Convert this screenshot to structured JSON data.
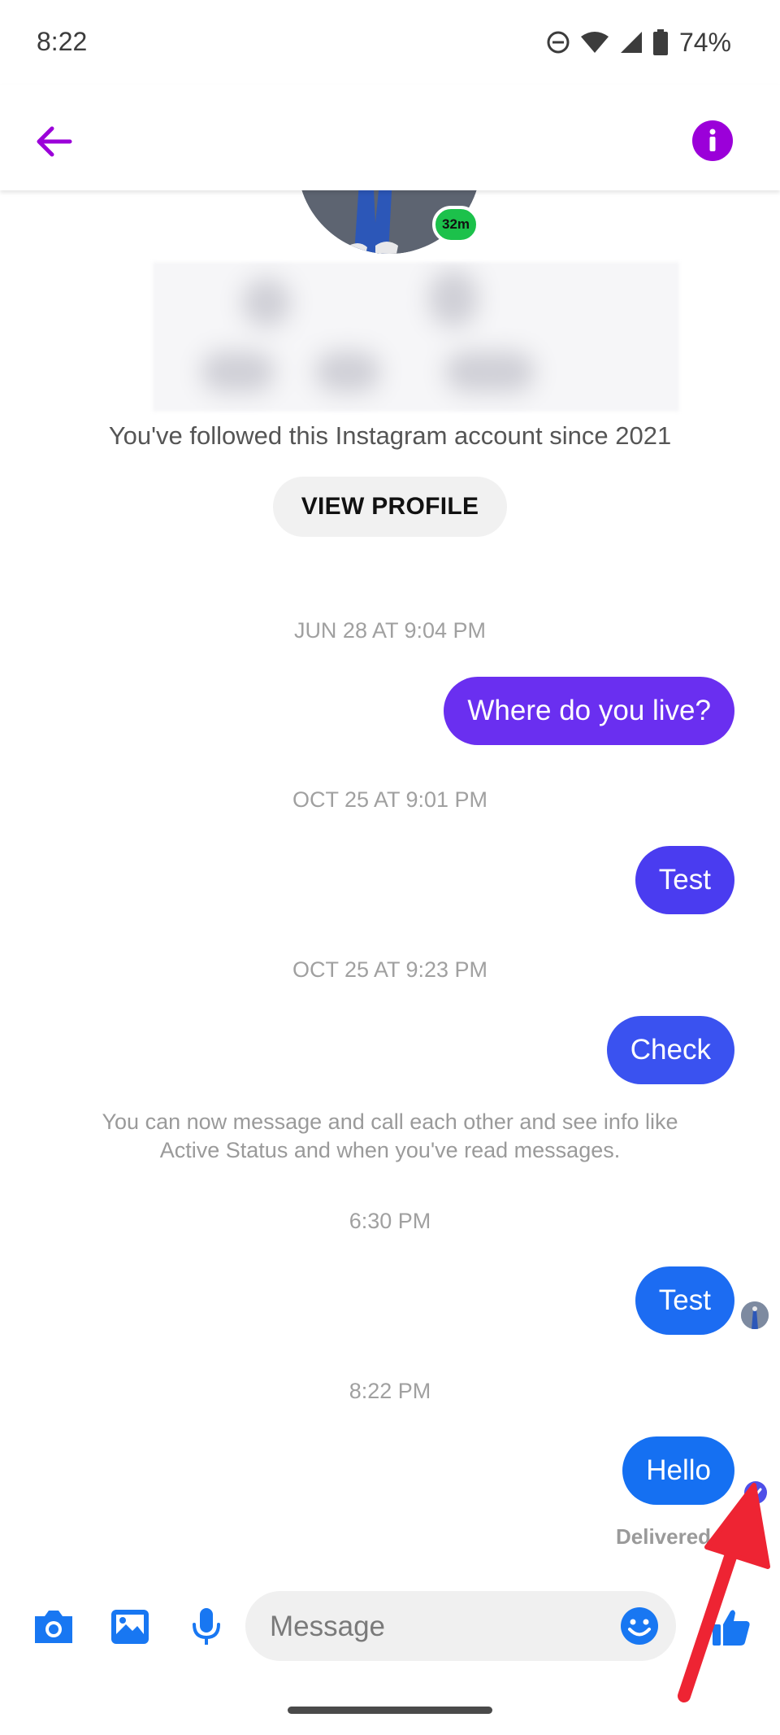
{
  "status_bar": {
    "time": "8:22",
    "battery_percent": "74%",
    "icons": [
      "do-not-disturb-icon",
      "wifi-icon",
      "cell-signal-icon",
      "battery-icon"
    ]
  },
  "header": {
    "icons": [
      "back-arrow-icon",
      "info-icon"
    ],
    "accent_color": "#9b00d9"
  },
  "profile": {
    "active_badge": "32m",
    "follow_text": "You've followed this Instagram account since 2021",
    "view_profile_label": "VIEW PROFILE"
  },
  "messages": [
    {
      "timestamp": "JUN 28 AT 9:04 PM",
      "text": "Where do you live?",
      "color": "#6a2ff0"
    },
    {
      "timestamp": "OCT 25 AT 9:01 PM",
      "text": "Test",
      "color": "#4a3cf0"
    },
    {
      "timestamp": "OCT 25 AT 9:23 PM",
      "text": "Check",
      "color": "#3a52f0"
    },
    {
      "timestamp": "6:30 PM",
      "text": "Test",
      "color": "#1c6cf2"
    },
    {
      "timestamp": "8:22 PM",
      "text": "Hello",
      "color": "#1570f2"
    }
  ],
  "system_message": "You can now message and call each other and see info like Active Status and when you've read messages.",
  "delivery_status": "Delivered",
  "composer": {
    "placeholder": "Message",
    "icons": [
      "camera-icon",
      "gallery-icon",
      "microphone-icon",
      "emoji-icon",
      "thumbs-up-icon"
    ],
    "icon_color": "#1877f2"
  }
}
